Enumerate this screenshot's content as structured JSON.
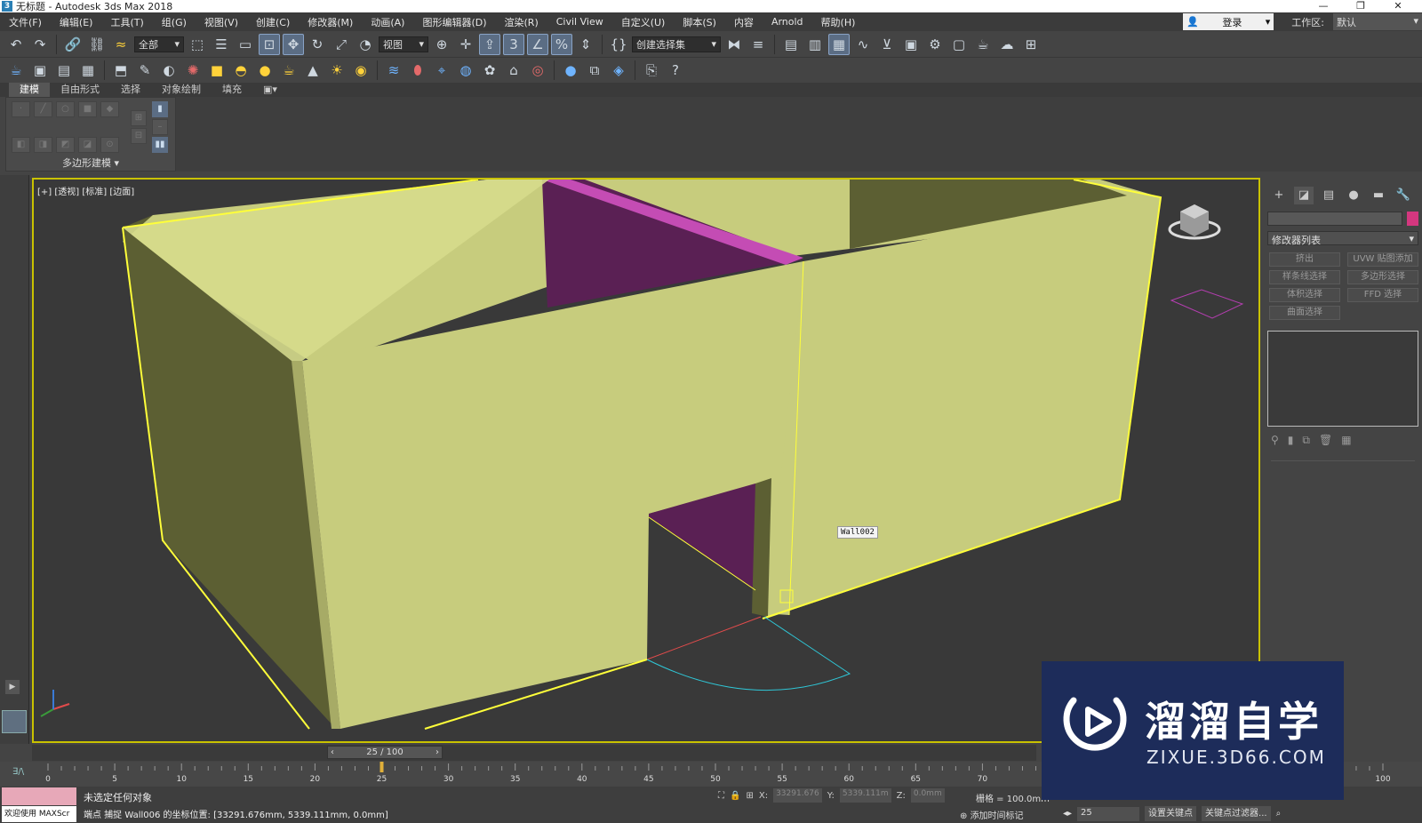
{
  "window": {
    "title": "无标题 - Autodesk 3ds Max 2018",
    "app_icon": "3",
    "minimize": "—",
    "restore": "❐",
    "close": "✕"
  },
  "menu": {
    "items": [
      "文件(F)",
      "编辑(E)",
      "工具(T)",
      "组(G)",
      "视图(V)",
      "创建(C)",
      "修改器(M)",
      "动画(A)",
      "图形编辑器(D)",
      "渲染(R)",
      "Civil View",
      "自定义(U)",
      "脚本(S)",
      "内容",
      "Arnold",
      "帮助(H)"
    ],
    "login": "登录",
    "workspace_label": "工作区:",
    "workspace_value": "默认"
  },
  "toolbar": {
    "selection_filter": "全部",
    "ref_coord": "视图",
    "named_selection": "创建选择集"
  },
  "ribbon": {
    "tabs": [
      "建模",
      "自由形式",
      "选择",
      "对象绘制",
      "填充"
    ],
    "active_tab": "建模",
    "panel_label": "多边形建模 ▾"
  },
  "viewport": {
    "label": "[+] [透视] [标准] [边面]",
    "object_tooltip": "Wall002",
    "colors": {
      "wall": "#c7cc7d",
      "wall_dark": "#5c5f33",
      "wall_mid": "#a7ab66",
      "magenta": "#5a2054",
      "magenta_light": "#c44cb4",
      "select": "#ffff3a",
      "door_arc": "#2fc6d6"
    }
  },
  "command_panel": {
    "tabs": [
      "create-icon",
      "modify-icon",
      "hierarchy-icon",
      "motion-icon",
      "display-icon",
      "utilities-icon"
    ],
    "modifier_list": "修改器列表",
    "buttons": [
      "挤出",
      "UVW 贴图添加",
      "样条线选择",
      "多边形选择",
      "体积选择",
      "FFD 选择",
      "曲面选择"
    ]
  },
  "timeline": {
    "frame_display": "25 / 100",
    "tick_labels": [
      "0",
      "5",
      "10",
      "15",
      "20",
      "25",
      "30",
      "35",
      "40",
      "45",
      "50",
      "55",
      "60",
      "65",
      "70",
      "100"
    ],
    "track_icon": "∃/\\"
  },
  "status": {
    "selection": "未选定任何对象",
    "prompt": "端点 捕捉 Wall006 的坐标位置: [33291.676mm, 5339.111mm, 0.0mm]",
    "welcome": "欢迎使用 MAXScr",
    "x_label": "X:",
    "x_value": "33291.676",
    "y_label": "Y:",
    "y_value": "5339.111m",
    "z_label": "Z:",
    "z_value": "0.0mm",
    "grid": "栅格 = 100.0mm",
    "add_time_tag": "添加时间标记",
    "current_frame": "25",
    "set_key": "设置关键点",
    "key_filters": "关键点过滤器..."
  },
  "watermark": {
    "title": "溜溜自学",
    "subtitle": "ZIXUE.3D66.COM"
  }
}
